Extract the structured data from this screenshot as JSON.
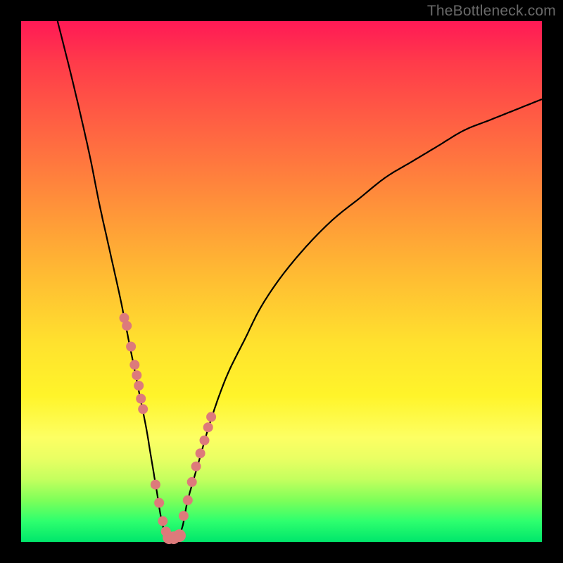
{
  "watermark": "TheBottleneck.com",
  "chart_data": {
    "type": "line",
    "title": "",
    "xlabel": "",
    "ylabel": "",
    "xlim": [
      0,
      100
    ],
    "ylim": [
      0,
      100
    ],
    "grid": false,
    "legend": false,
    "series": [
      {
        "name": "curve",
        "x": [
          7,
          10,
          13,
          15,
          17,
          19,
          20,
          21,
          22,
          23,
          24,
          25,
          26,
          27,
          28,
          29,
          30,
          31,
          32,
          34,
          36,
          38,
          40,
          43,
          46,
          50,
          55,
          60,
          65,
          70,
          75,
          80,
          85,
          90,
          95,
          100
        ],
        "values": [
          100,
          88,
          75,
          65,
          56,
          47,
          42,
          37,
          32,
          27,
          22,
          16,
          10,
          4,
          0.8,
          0.6,
          0.8,
          3,
          8,
          15,
          22,
          28,
          33,
          39,
          45,
          51,
          57,
          62,
          66,
          70,
          73,
          76,
          79,
          81,
          83,
          85
        ]
      }
    ],
    "markers": {
      "name": "highlight-dots",
      "x": [
        19.8,
        20.3,
        21.1,
        21.8,
        22.2,
        22.6,
        23.0,
        23.4,
        25.8,
        26.5,
        27.2,
        27.8,
        28.4,
        29.3,
        30.4,
        31.2,
        32.0,
        32.8,
        33.6,
        34.4,
        35.2,
        35.9,
        36.5
      ],
      "values": [
        43,
        41.5,
        37.5,
        34,
        32,
        30,
        27.5,
        25.5,
        11,
        7.5,
        4,
        2,
        0.8,
        0.8,
        1.2,
        5,
        8,
        11.5,
        14.5,
        17,
        19.5,
        22,
        24
      ]
    }
  }
}
